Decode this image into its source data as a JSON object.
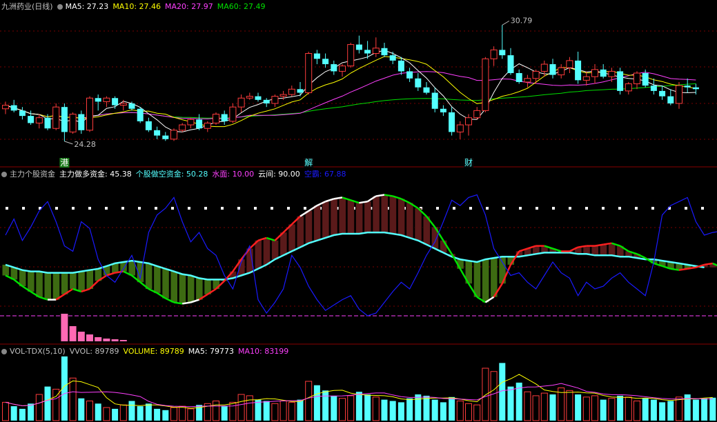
{
  "colors": {
    "up": "#ff3c3c",
    "down": "#54ffff",
    "ma5": "#ffffff",
    "ma10": "#ffff00",
    "ma20": "#ff40ff",
    "ma60": "#00e000",
    "text": "#c0c0c0",
    "grid": "#7a0000",
    "white": "#ffffff",
    "cyan": "#54ffff",
    "blue": "#1a1aff",
    "pink": "#ff69b4",
    "green": "#00e000",
    "dark_green": "#3d6b12",
    "dark_red": "#5a1a1a",
    "red": "#ff2020"
  },
  "panel1": {
    "title": "九洲药业(日线)",
    "ma5": "MA5: 27.23",
    "ma10": "MA10: 27.46",
    "ma20": "MA20: 27.97",
    "ma60": "MA60: 27.49",
    "high_label": "30.79",
    "low_label": "24.28",
    "markers": [
      "港",
      "解",
      "财"
    ]
  },
  "panel2": {
    "title": "主力个股资金",
    "l1": "主力做多资金: 45.38",
    "l2": "个股做空资金: 50.28",
    "l3": "水面: 10.00",
    "l4": "云间: 90.00",
    "l5": "空霸: 67.88"
  },
  "panel3": {
    "title": "VOL-TDX(5,10)",
    "l1": "VVOL: 89789",
    "l2": "VOLUME: 89789",
    "l3": "MA5: 79773",
    "l4": "MA10: 83199"
  },
  "chart_data": [
    {
      "type": "candlestick",
      "title": "九洲药业(日线)",
      "ylim": [
        23.0,
        31.5
      ],
      "ohlc": [
        [
          26.1,
          26.5,
          25.8,
          26.3
        ],
        [
          26.3,
          26.6,
          25.9,
          26.0
        ],
        [
          26.0,
          26.2,
          25.5,
          25.7
        ],
        [
          25.7,
          26.0,
          25.2,
          25.3
        ],
        [
          25.3,
          25.8,
          25.0,
          25.6
        ],
        [
          25.6,
          25.8,
          24.9,
          25.0
        ],
        [
          25.0,
          26.4,
          24.9,
          26.2
        ],
        [
          26.2,
          26.4,
          24.28,
          24.8
        ],
        [
          24.8,
          25.9,
          24.7,
          25.8
        ],
        [
          25.8,
          26.0,
          24.7,
          24.9
        ],
        [
          24.9,
          26.8,
          24.8,
          26.7
        ],
        [
          26.7,
          26.9,
          26.0,
          26.5
        ],
        [
          26.5,
          26.8,
          26.2,
          26.7
        ],
        [
          26.7,
          26.8,
          26.1,
          26.3
        ],
        [
          26.3,
          26.6,
          26.0,
          26.4
        ],
        [
          26.4,
          26.5,
          26.0,
          26.1
        ],
        [
          26.1,
          26.2,
          25.3,
          25.4
        ],
        [
          25.4,
          25.6,
          24.8,
          24.9
        ],
        [
          24.9,
          25.1,
          24.4,
          24.6
        ],
        [
          24.6,
          24.8,
          24.3,
          24.4
        ],
        [
          24.4,
          25.0,
          24.3,
          24.9
        ],
        [
          24.9,
          25.3,
          24.8,
          25.2
        ],
        [
          25.2,
          25.6,
          25.0,
          25.5
        ],
        [
          25.5,
          25.8,
          24.9,
          25.0
        ],
        [
          25.0,
          25.4,
          24.8,
          25.3
        ],
        [
          25.3,
          25.9,
          25.2,
          25.8
        ],
        [
          25.8,
          26.0,
          25.2,
          25.4
        ],
        [
          25.4,
          26.4,
          25.3,
          26.2
        ],
        [
          26.2,
          26.9,
          25.9,
          26.7
        ],
        [
          26.7,
          27.0,
          26.6,
          26.8
        ],
        [
          26.8,
          27.0,
          26.5,
          26.6
        ],
        [
          26.6,
          26.7,
          26.2,
          26.4
        ],
        [
          26.4,
          26.9,
          26.2,
          26.8
        ],
        [
          26.8,
          27.1,
          26.6,
          26.9
        ],
        [
          26.9,
          27.4,
          26.8,
          27.2
        ],
        [
          27.2,
          27.6,
          26.8,
          27.0
        ],
        [
          27.0,
          29.3,
          26.9,
          29.2
        ],
        [
          29.2,
          29.4,
          28.6,
          28.9
        ],
        [
          28.9,
          29.2,
          28.4,
          28.6
        ],
        [
          28.6,
          28.8,
          28.0,
          28.2
        ],
        [
          28.2,
          28.6,
          27.9,
          28.5
        ],
        [
          28.5,
          29.8,
          28.4,
          29.7
        ],
        [
          29.7,
          30.2,
          29.2,
          29.4
        ],
        [
          29.4,
          29.9,
          28.9,
          29.2
        ],
        [
          29.2,
          30.1,
          29.0,
          29.5
        ],
        [
          29.5,
          29.8,
          29.0,
          29.1
        ],
        [
          29.1,
          29.3,
          28.6,
          28.8
        ],
        [
          28.8,
          29.0,
          28.0,
          28.2
        ],
        [
          28.2,
          28.4,
          27.6,
          27.8
        ],
        [
          27.8,
          28.1,
          27.1,
          27.3
        ],
        [
          27.3,
          27.6,
          26.9,
          27.0
        ],
        [
          27.0,
          27.3,
          25.9,
          26.1
        ],
        [
          26.1,
          26.3,
          25.7,
          25.9
        ],
        [
          25.9,
          26.2,
          24.6,
          24.8
        ],
        [
          24.8,
          25.4,
          24.4,
          25.2
        ],
        [
          25.2,
          25.8,
          24.6,
          25.6
        ],
        [
          25.6,
          26.2,
          25.5,
          26.0
        ],
        [
          26.0,
          29.0,
          25.9,
          28.9
        ],
        [
          28.9,
          29.6,
          28.5,
          29.4
        ],
        [
          29.4,
          30.79,
          28.9,
          29.1
        ],
        [
          29.1,
          29.5,
          28.0,
          28.1
        ],
        [
          28.1,
          28.3,
          27.5,
          27.6
        ],
        [
          27.6,
          28.0,
          27.3,
          27.8
        ],
        [
          27.8,
          28.3,
          27.5,
          28.2
        ],
        [
          28.2,
          28.8,
          27.9,
          28.6
        ],
        [
          28.6,
          28.9,
          27.8,
          28.0
        ],
        [
          28.0,
          28.6,
          27.8,
          28.4
        ],
        [
          28.4,
          29.0,
          28.1,
          28.8
        ],
        [
          28.8,
          29.3,
          27.5,
          27.7
        ],
        [
          27.7,
          28.2,
          27.4,
          27.9
        ],
        [
          27.9,
          28.6,
          27.5,
          28.3
        ],
        [
          28.3,
          28.6,
          27.8,
          27.9
        ],
        [
          27.9,
          28.4,
          27.6,
          28.2
        ],
        [
          28.2,
          28.4,
          26.9,
          27.1
        ],
        [
          27.1,
          27.6,
          26.9,
          27.5
        ],
        [
          27.5,
          28.2,
          27.2,
          28.1
        ],
        [
          28.1,
          28.3,
          27.3,
          27.4
        ],
        [
          27.4,
          27.8,
          26.9,
          27.1
        ],
        [
          27.1,
          27.4,
          26.6,
          26.8
        ],
        [
          26.8,
          27.2,
          26.3,
          26.4
        ],
        [
          26.4,
          27.6,
          26.1,
          27.4
        ],
        [
          27.4,
          27.8,
          27.0,
          27.3
        ],
        [
          27.3,
          27.5,
          26.9,
          27.2
        ]
      ],
      "ma_values": {
        "MA5": 27.23,
        "MA10": 27.46,
        "MA20": 27.97,
        "MA60": 27.49
      }
    },
    {
      "type": "line",
      "title": "主力个股资金",
      "ylim": [
        -10,
        110
      ],
      "series": [
        {
          "name": "主力做多资金",
          "values": [
            40,
            37,
            32,
            28,
            24,
            22,
            22,
            26,
            30,
            28,
            30,
            36,
            40,
            42,
            43,
            40,
            35,
            30,
            27,
            23,
            20,
            19,
            20,
            22,
            26,
            30,
            36,
            43,
            52,
            60,
            66,
            68,
            66,
            72,
            78,
            84,
            88,
            92,
            95,
            97,
            98,
            96,
            94,
            95,
            99,
            100,
            99,
            97,
            94,
            90,
            84,
            76,
            66,
            56,
            45,
            34,
            24,
            20,
            24,
            34,
            48,
            58,
            60,
            62,
            62,
            60,
            58,
            58,
            61,
            62,
            62,
            63,
            64,
            62,
            58,
            56,
            53,
            49,
            47,
            45,
            44,
            45,
            46,
            48,
            49,
            46
          ]
        },
        {
          "name": "个股做空资金",
          "values": [
            48,
            46,
            44,
            43,
            43,
            42,
            42,
            42,
            42,
            43,
            44,
            45,
            47,
            49,
            50,
            51,
            50,
            49,
            47,
            45,
            43,
            41,
            40,
            38,
            37,
            37,
            37,
            38,
            40,
            42,
            45,
            48,
            52,
            55,
            58,
            61,
            64,
            66,
            68,
            70,
            71,
            71,
            71,
            72,
            72,
            72,
            71,
            70,
            68,
            66,
            63,
            60,
            57,
            54,
            52,
            51,
            50,
            52,
            53,
            54,
            54,
            54,
            55,
            56,
            57,
            57,
            57,
            57,
            56,
            56,
            55,
            55,
            55,
            54,
            54,
            53,
            52,
            52,
            51,
            50,
            49,
            48,
            47,
            46
          ]
        },
        {
          "name": "水面",
          "values": [
            10
          ]
        },
        {
          "name": "云间",
          "values": [
            90
          ]
        },
        {
          "name": "空霸",
          "values": [
            70,
            82,
            66,
            76,
            88,
            95,
            80,
            62,
            58,
            80,
            75,
            52,
            40,
            35,
            45,
            55,
            38,
            72,
            85,
            90,
            98,
            80,
            65,
            72,
            60,
            55,
            40,
            30,
            50,
            62,
            22,
            12,
            20,
            30,
            55,
            46,
            32,
            22,
            14,
            18,
            22,
            25,
            15,
            10,
            12,
            20,
            28,
            35,
            30,
            42,
            55,
            65,
            80,
            96,
            92,
            98,
            100,
            85,
            60,
            50,
            40,
            42,
            35,
            30,
            40,
            50,
            42,
            38,
            25,
            35,
            30,
            32,
            38,
            42,
            35,
            30,
            25,
            50,
            85,
            92,
            95,
            98,
            80,
            70,
            72,
            73
          ]
        }
      ]
    },
    {
      "type": "bar",
      "title": "VOL-TDX(5,10)",
      "ylim": [
        0,
        100000
      ],
      "values": [
        28000,
        22000,
        18000,
        26000,
        40000,
        52000,
        48000,
        98000,
        65000,
        34000,
        30000,
        26000,
        20000,
        18000,
        24000,
        30000,
        22000,
        26000,
        18000,
        16000,
        20000,
        22000,
        18000,
        24000,
        26000,
        30000,
        22000,
        28000,
        40000,
        38000,
        32000,
        30000,
        26000,
        30000,
        28000,
        32000,
        60000,
        54000,
        46000,
        38000,
        34000,
        38000,
        44000,
        40000,
        36000,
        32000,
        30000,
        28000,
        34000,
        40000,
        38000,
        32000,
        28000,
        36000,
        30000,
        26000,
        24000,
        80000,
        75000,
        88000,
        52000,
        58000,
        44000,
        38000,
        42000,
        40000,
        50000,
        46000,
        40000,
        36000,
        38000,
        32000,
        34000,
        38000,
        36000,
        30000,
        34000,
        32000,
        28000,
        30000,
        36000,
        40000,
        32000,
        34000,
        35000
      ],
      "vma5": 79773,
      "vma10": 83199
    }
  ]
}
